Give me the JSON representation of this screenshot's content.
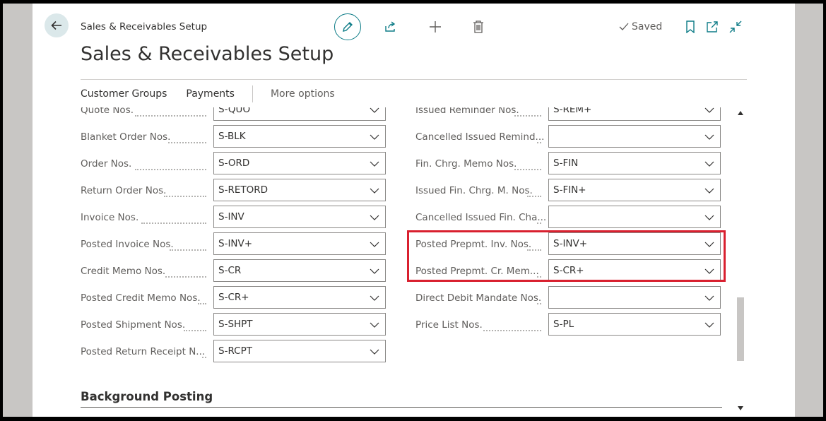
{
  "header": {
    "breadcrumb": "Sales & Receivables Setup",
    "title": "Sales & Receivables Setup",
    "saved_label": "Saved"
  },
  "actions": {
    "customer_groups": "Customer Groups",
    "payments": "Payments",
    "more_options": "More options"
  },
  "left_fields": [
    {
      "label": "Quote Nos.",
      "value": "S-QUO"
    },
    {
      "label": "Blanket Order Nos.",
      "value": "S-BLK"
    },
    {
      "label": "Order Nos.",
      "value": "S-ORD"
    },
    {
      "label": "Return Order Nos.",
      "value": "S-RETORD"
    },
    {
      "label": "Invoice Nos.",
      "value": "S-INV"
    },
    {
      "label": "Posted Invoice Nos.",
      "value": "S-INV+"
    },
    {
      "label": "Credit Memo Nos.",
      "value": "S-CR"
    },
    {
      "label": "Posted Credit Memo Nos.",
      "value": "S-CR+"
    },
    {
      "label": "Posted Shipment Nos.",
      "value": "S-SHPT"
    },
    {
      "label": "Posted Return Receipt N...",
      "value": "S-RCPT"
    }
  ],
  "right_fields": [
    {
      "label": "Issued Reminder Nos.",
      "value": "S-REM+"
    },
    {
      "label": "Cancelled Issued Remind...",
      "value": ""
    },
    {
      "label": "Fin. Chrg. Memo Nos.",
      "value": "S-FIN"
    },
    {
      "label": "Issued Fin. Chrg. M. Nos.",
      "value": "S-FIN+"
    },
    {
      "label": "Cancelled Issued Fin. Cha...",
      "value": ""
    },
    {
      "label": "Posted Prepmt. Inv. Nos.",
      "value": "S-INV+"
    },
    {
      "label": "Posted Prepmt. Cr. Mem...",
      "value": "S-CR+"
    },
    {
      "label": "Direct Debit Mandate Nos.",
      "value": ""
    },
    {
      "label": "Price List Nos.",
      "value": "S-PL"
    }
  ],
  "sections": {
    "background_posting": "Background Posting"
  },
  "colors": {
    "accent": "#0d7c87",
    "highlight_border": "#d9202f"
  }
}
